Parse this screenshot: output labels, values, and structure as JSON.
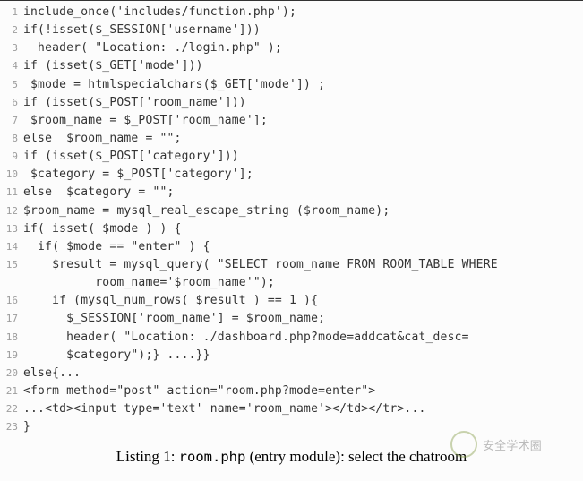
{
  "listing": {
    "number": "1",
    "file": "room.php",
    "description": "(entry module): select the chatroom"
  },
  "watermark": "安全学术圈",
  "code_lines": [
    {
      "n": "1",
      "t": "include_once('includes/function.php');"
    },
    {
      "n": "2",
      "t": "if(!isset($_SESSION['username']))"
    },
    {
      "n": "3",
      "t": "  header( \"Location: ./login.php\" );"
    },
    {
      "n": "4",
      "t": "if (isset($_GET['mode']))"
    },
    {
      "n": "5",
      "t": " $mode = htmlspecialchars($_GET['mode']) ;"
    },
    {
      "n": "6",
      "t": "if (isset($_POST['room_name']))"
    },
    {
      "n": "7",
      "t": " $room_name = $_POST['room_name'];"
    },
    {
      "n": "8",
      "t": "else  $room_name = \"\";"
    },
    {
      "n": "9",
      "t": "if (isset($_POST['category']))"
    },
    {
      "n": "10",
      "t": " $category = $_POST['category'];"
    },
    {
      "n": "11",
      "t": "else  $category = \"\";"
    },
    {
      "n": "12",
      "t": "$room_name = mysql_real_escape_string ($room_name);"
    },
    {
      "n": "13",
      "t": "if( isset( $mode ) ) {"
    },
    {
      "n": "14",
      "t": "  if( $mode == \"enter\" ) {"
    },
    {
      "n": "15",
      "t": "    $result = mysql_query( \"SELECT room_name FROM ROOM_TABLE WHERE"
    },
    {
      "n": "",
      "t": "          room_name='$room_name'\");"
    },
    {
      "n": "16",
      "t": "    if (mysql_num_rows( $result ) == 1 ){"
    },
    {
      "n": "17",
      "t": "      $_SESSION['room_name'] = $room_name;"
    },
    {
      "n": "18",
      "t": "      header( \"Location: ./dashboard.php?mode=addcat&cat_desc="
    },
    {
      "n": "19",
      "t": "      $category\");} ....}}"
    },
    {
      "n": "20",
      "t": "else{..."
    },
    {
      "n": "21",
      "t": "<form method=\"post\" action=\"room.php?mode=enter\">"
    },
    {
      "n": "22",
      "t": "...<td><input type='text' name='room_name'></td></tr>..."
    },
    {
      "n": "23",
      "t": "}"
    }
  ]
}
